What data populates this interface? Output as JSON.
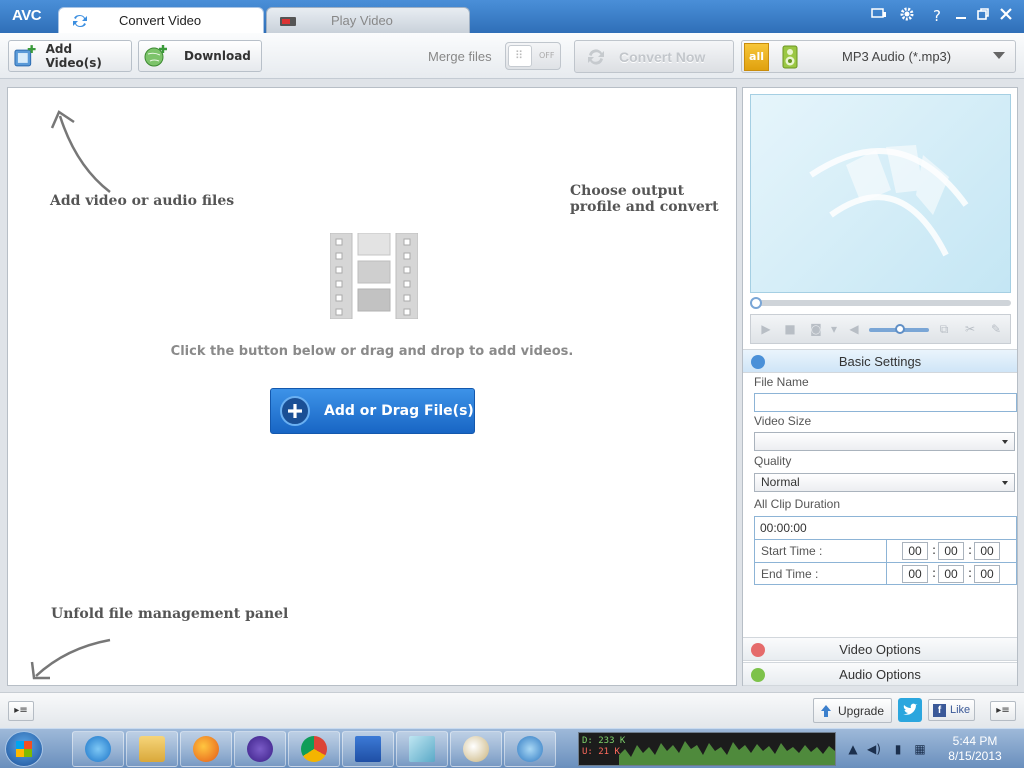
{
  "app": {
    "logo": "AVC",
    "tabs": [
      {
        "label": "Convert Video",
        "active": true
      },
      {
        "label": "Play Video",
        "active": false
      }
    ],
    "window_controls": [
      "monitor-icon",
      "gear-icon",
      "help-icon",
      "minimize-icon",
      "restore-icon",
      "close-icon"
    ],
    "help_glyph": "?"
  },
  "toolbar": {
    "add_videos_label": "Add Video(s)",
    "download_label": "Download",
    "merge_label": "Merge files",
    "merge_state": "OFF",
    "convert_label": "Convert Now",
    "profile_all_label": "all",
    "profile_value": "MP3 Audio (*.mp3)"
  },
  "main": {
    "hint_add": "Add video or audio files",
    "hint_profile": "Choose output profile and convert",
    "hint_unfold": "Unfold file management panel",
    "drop_text": "Click the button below or drag and drop to add videos.",
    "add_button_label": "Add or Drag File(s)"
  },
  "settings": {
    "basic_title": "Basic Settings",
    "file_name_label": "File Name",
    "file_name_value": "",
    "video_size_label": "Video Size",
    "video_size_value": "",
    "quality_label": "Quality",
    "quality_value": "Normal",
    "duration_label": "All Clip Duration",
    "duration_value": "00:00:00",
    "start_label": "Start Time :",
    "end_label": "End Time :",
    "start": [
      "00",
      "00",
      "00"
    ],
    "end": [
      "00",
      "00",
      "00"
    ],
    "time_separator": ":",
    "video_options_label": "Video Options",
    "audio_options_label": "Audio Options"
  },
  "bottom": {
    "upgrade_label": "Upgrade",
    "like_label": "Like",
    "fb_letter": "f"
  },
  "taskbar": {
    "apps": [
      "internet-explorer-icon",
      "file-explorer-icon",
      "firefox-icon",
      "bittorrent-icon",
      "chrome-icon",
      "word-icon",
      "notepad-icon",
      "paint-icon",
      "network-app-icon"
    ],
    "net_down": "D: 233 K",
    "net_up": "U: 21 K",
    "time": "5:44 PM",
    "date": "8/15/2013"
  },
  "colors": {
    "accent": "#2f6fb8",
    "add_button": "#1e73d2",
    "net_down": "#7fd36b",
    "net_up": "#ff6a5c"
  }
}
